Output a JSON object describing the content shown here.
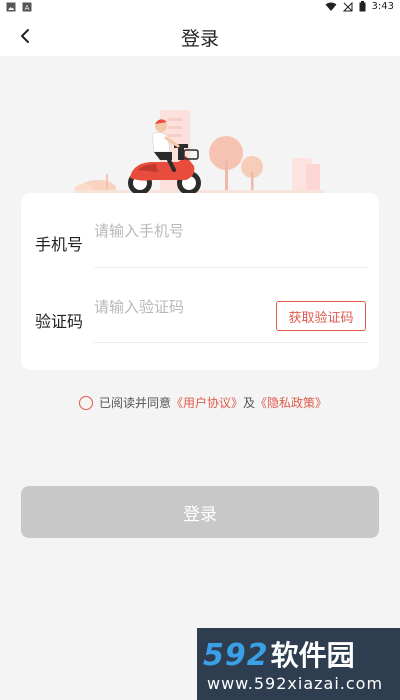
{
  "status_bar": {
    "time": "3:43"
  },
  "header": {
    "title": "登录"
  },
  "form": {
    "phone_label": "手机号",
    "phone_placeholder": "请输入手机号",
    "code_label": "验证码",
    "code_placeholder": "请输入验证码",
    "get_code_label": "获取验证码"
  },
  "agreement": {
    "prefix": "已阅读并同意",
    "user_agreement": "《用户协议》",
    "joiner": "及",
    "privacy_policy": "《隐私政策》"
  },
  "login_button": {
    "label": "登录"
  },
  "watermark": {
    "brand_num": "592",
    "brand_cn": "软件园",
    "url": "www.592xiazai.com"
  },
  "colors": {
    "accent": "#e05a4e",
    "disabled_button": "#c8c8c8",
    "background": "#f4f4f4"
  },
  "icons": [
    "image-icon",
    "notification-icon",
    "wifi-icon",
    "signal-icon",
    "battery-icon",
    "back-arrow-icon"
  ]
}
